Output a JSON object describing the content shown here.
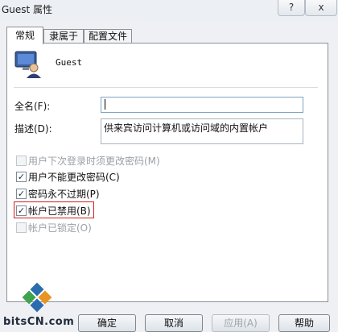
{
  "window": {
    "title": "Guest 属性",
    "help_button": "?",
    "close_button": "x"
  },
  "tabs": [
    {
      "label": "常规"
    },
    {
      "label": "隶属于"
    },
    {
      "label": "配置文件"
    }
  ],
  "user": {
    "name": "Guest"
  },
  "fields": {
    "full_name": {
      "label": "全名(F):",
      "value": ""
    },
    "description": {
      "label": "描述(D):",
      "value": "供来宾访问计算机或访问域的内置帐户"
    }
  },
  "options": [
    {
      "label": "用户下次登录时须更改密码(M)",
      "checked": false,
      "enabled": false
    },
    {
      "label": "用户不能更改密码(C)",
      "checked": true,
      "enabled": true
    },
    {
      "label": "密码永不过期(P)",
      "checked": true,
      "enabled": true
    },
    {
      "label": "帐户已禁用(B)",
      "checked": true,
      "enabled": true,
      "highlighted": true
    },
    {
      "label": "帐户已锁定(O)",
      "checked": false,
      "enabled": false
    }
  ],
  "buttons": {
    "ok": "确定",
    "cancel": "取消",
    "apply": "应用(A)",
    "help": "帮助"
  },
  "watermark": {
    "site": "bitsCN.com"
  },
  "colors": {
    "highlight_border": "#d02020",
    "field_border": "#7fa4c4"
  }
}
